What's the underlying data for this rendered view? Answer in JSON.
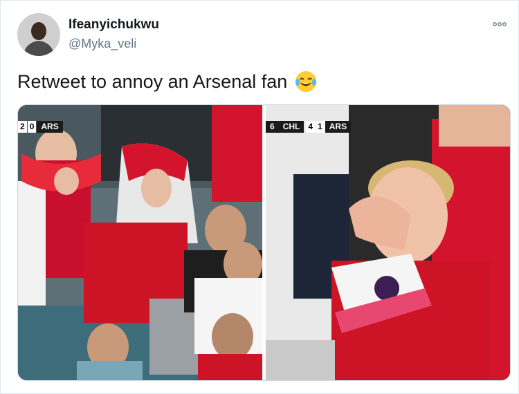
{
  "tweet": {
    "display_name": "Ifeanyichukwu",
    "handle": "@Myka_veli",
    "text": "Retweet to annoy an Arsenal fan",
    "emoji": "face-with-tears-of-joy"
  },
  "media": {
    "left_scoreboard": {
      "home_score": "2",
      "away_score": "0",
      "team": "ARS"
    },
    "right_scoreboard": {
      "prefix": "6",
      "team1": "CHL",
      "score1": "4",
      "score2": "1",
      "team2": "ARS"
    }
  },
  "colors": {
    "arsenal_red": "#c8102e",
    "name_text": "#14171a",
    "secondary_text": "#657786"
  }
}
